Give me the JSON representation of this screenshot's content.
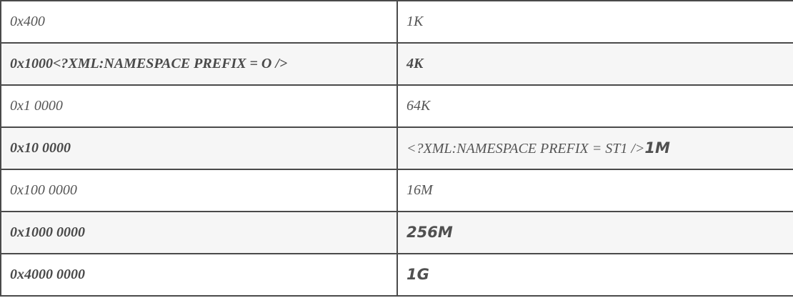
{
  "table": {
    "rows": [
      {
        "address": "0x400",
        "size": "1K"
      },
      {
        "address": "0x1000<?XML:NAMESPACE PREFIX = O />",
        "size": "4K"
      },
      {
        "address": "0x1 0000",
        "size": "64K"
      },
      {
        "address": "0x10 0000",
        "size_prefix": "<?XML:NAMESPACE PREFIX = ST1 />",
        "size": "1M"
      },
      {
        "address": "0x100 0000",
        "size": "16M"
      },
      {
        "address": "0x1000 0000",
        "size": "256M"
      },
      {
        "address": "0x4000 0000",
        "size": "1G"
      }
    ]
  }
}
